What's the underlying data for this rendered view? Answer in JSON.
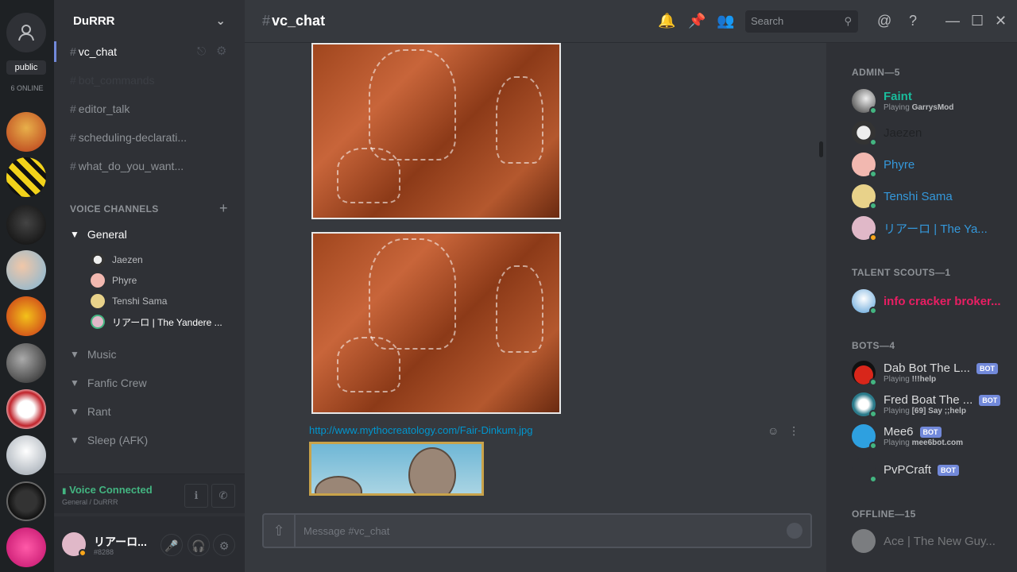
{
  "rail": {
    "public_label": "public",
    "online_label": "6 ONLINE"
  },
  "guild": {
    "name": "DuRRR",
    "channels": [
      {
        "label": "vc_chat"
      },
      {
        "label": "bot_commands"
      },
      {
        "label": "editor_talk"
      },
      {
        "label": "scheduling-declarati..."
      },
      {
        "label": "what_do_you_want..."
      }
    ],
    "voice_section": "VOICE CHANNELS",
    "voice_groups": [
      {
        "label": "General"
      },
      {
        "label": "Music"
      },
      {
        "label": "Fanfic Crew"
      },
      {
        "label": "Rant"
      },
      {
        "label": "Sleep (AFK)"
      }
    ],
    "voice_users": [
      {
        "label": "Jaezen"
      },
      {
        "label": "Phyre"
      },
      {
        "label": "Tenshi Sama"
      },
      {
        "label": "リアーロ | The Yandere ..."
      }
    ]
  },
  "voice_status": {
    "title": "Voice Connected",
    "subtitle": "General / DuRRR"
  },
  "user": {
    "name": "リアーロ...",
    "tag": "#8288"
  },
  "chat": {
    "channel": "vc_chat",
    "search_placeholder": "Search",
    "link_text": "http://www.mythocreatology.com/Fair-Dinkum.jpg",
    "composer_placeholder": "Message #vc_chat"
  },
  "members": {
    "admin_header": "ADMIN—5",
    "talent_header": "TALENT SCOUTS—1",
    "bots_header": "BOTS—4",
    "offline_header": "OFFLINE—15",
    "bot_badge": "BOT",
    "admin": [
      {
        "name": "Faint",
        "activity_prefix": "Playing",
        "activity": "GarrysMod",
        "color": "#1abc9c"
      },
      {
        "name": "Jaezen",
        "color": "#202225"
      },
      {
        "name": "Phyre",
        "color": "#3498db"
      },
      {
        "name": "Tenshi Sama",
        "color": "#3498db"
      },
      {
        "name": "リアーロ | The Ya...",
        "color": "#3498db"
      }
    ],
    "talent": [
      {
        "name": "info cracker broker...",
        "color": "#e91e63"
      }
    ],
    "bots": [
      {
        "name": "Dab Bot The L...",
        "activity_prefix": "Playing",
        "activity": "!!!help"
      },
      {
        "name": "Fred Boat The ...",
        "activity_prefix": "Playing",
        "activity": "[69] Say ;;help"
      },
      {
        "name": "Mee6",
        "activity_prefix": "Playing",
        "activity": "mee6bot.com"
      },
      {
        "name": "PvPCraft"
      }
    ],
    "offline": [
      {
        "name": "Ace | The New Guy..."
      }
    ]
  }
}
